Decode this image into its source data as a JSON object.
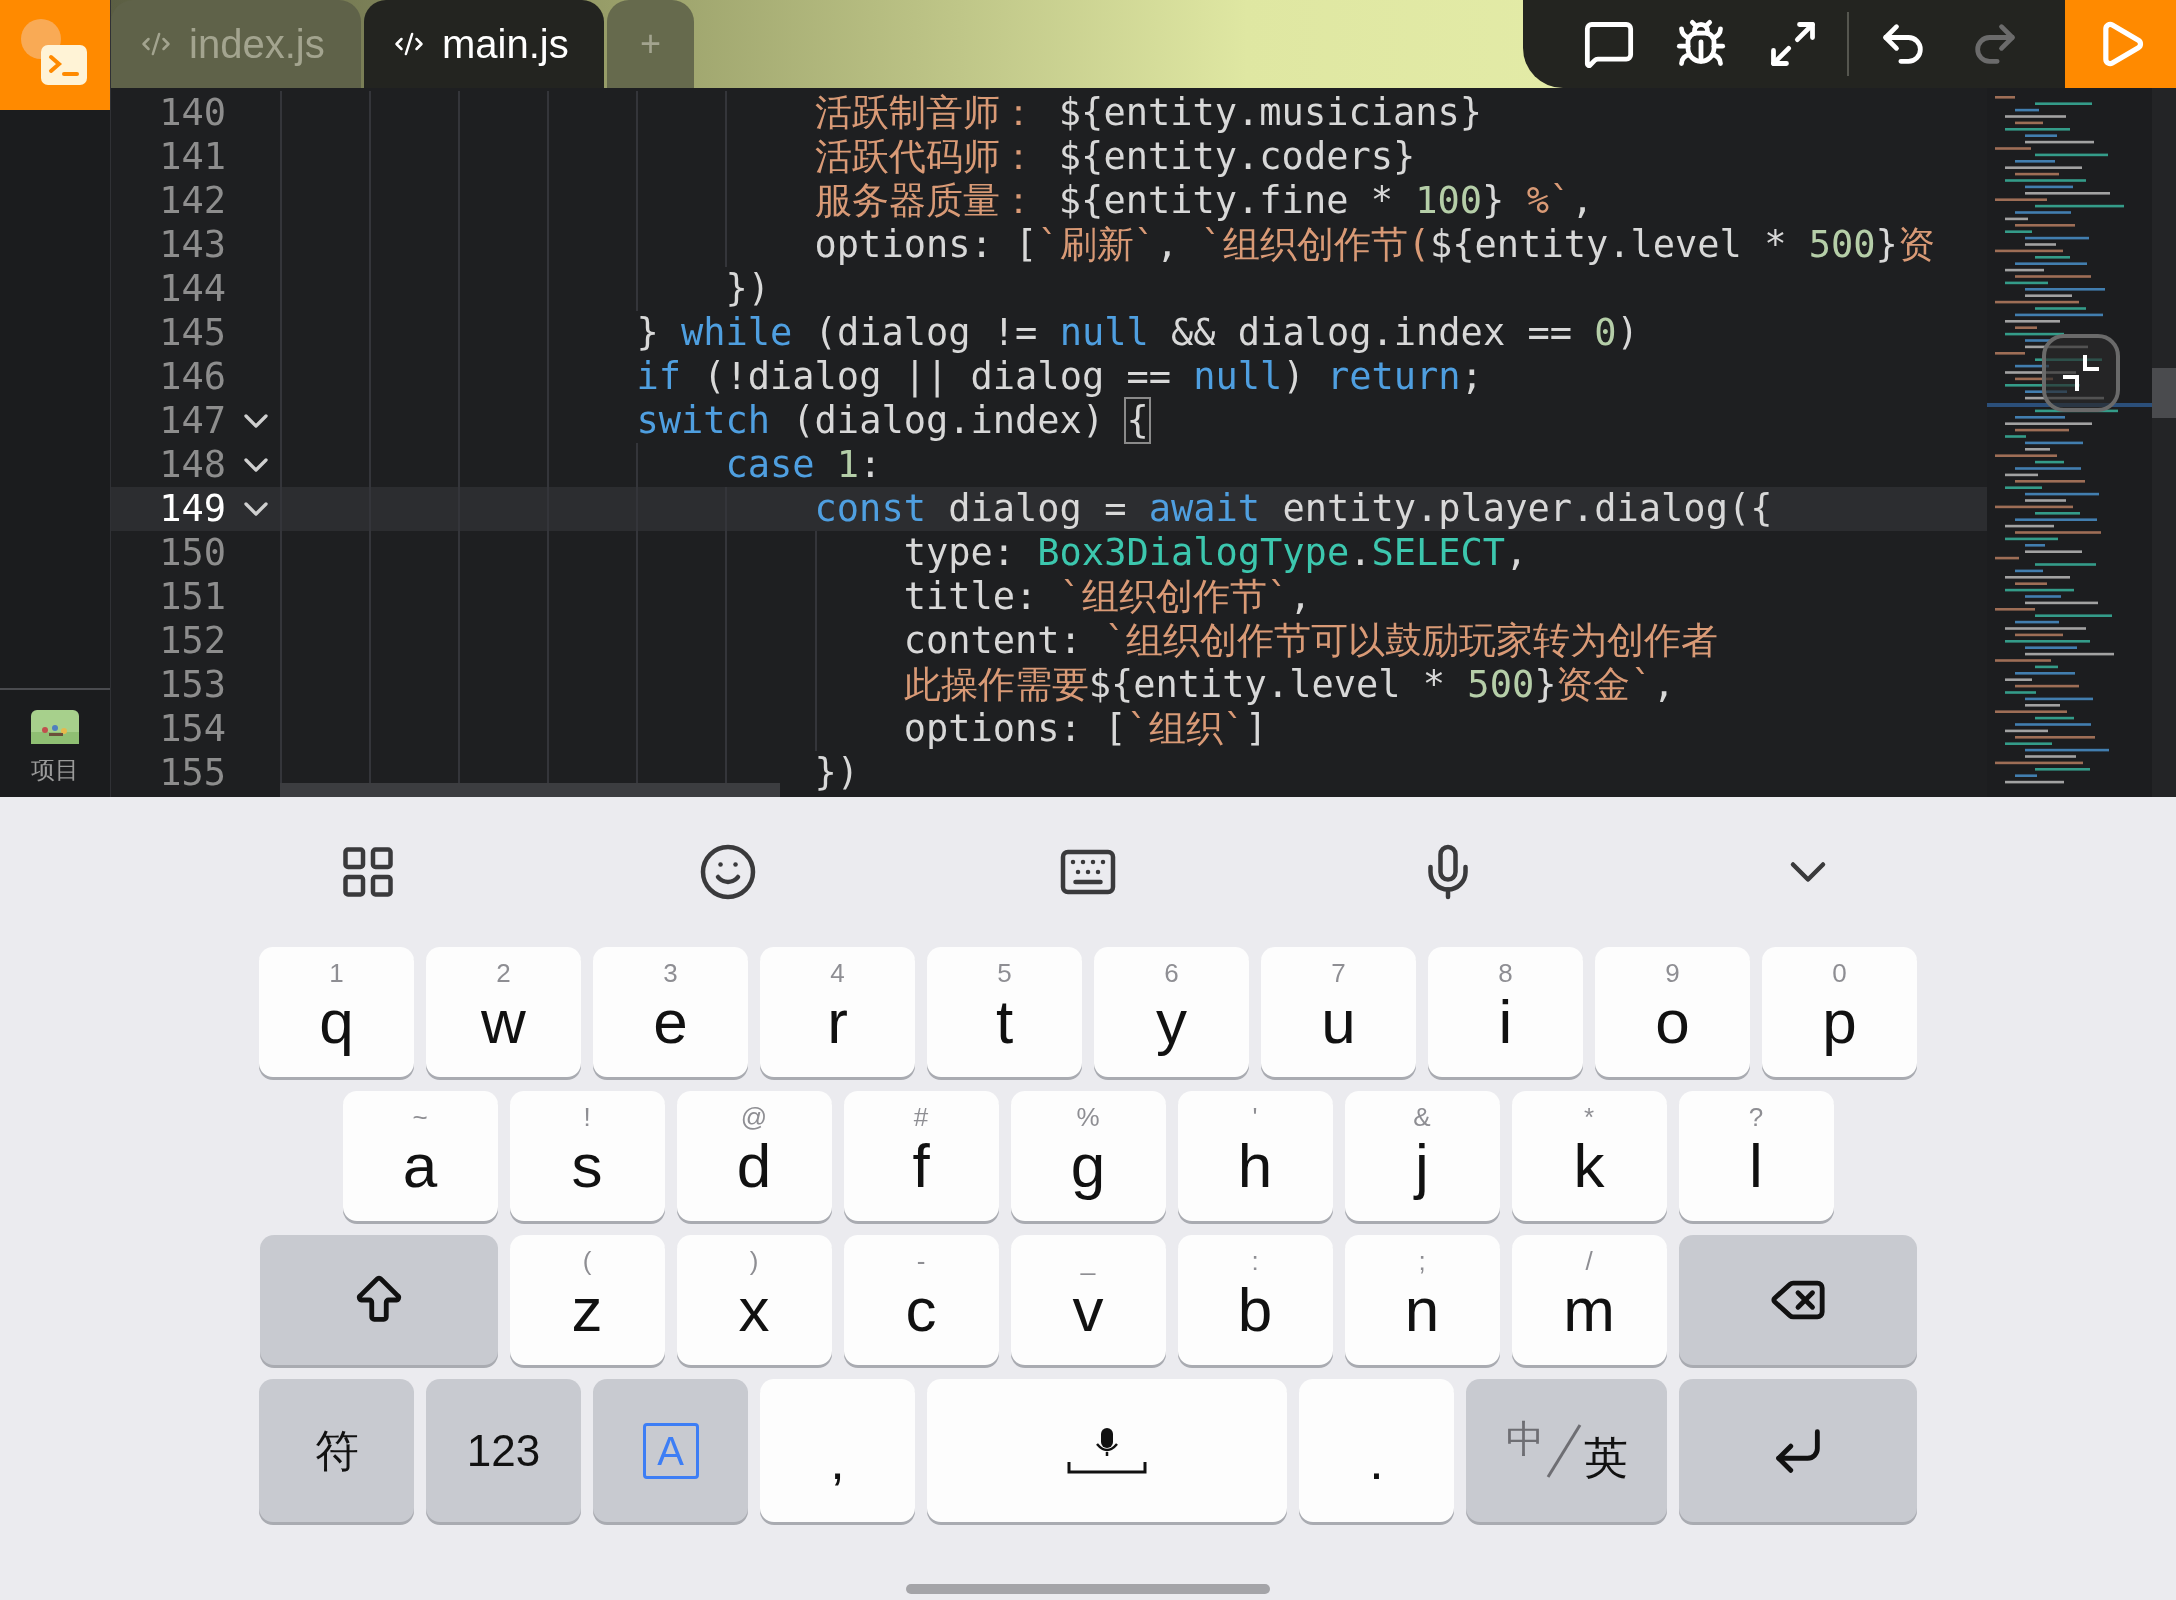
{
  "tabs": [
    {
      "label": "index.js",
      "selected": false
    },
    {
      "label": "main.js",
      "selected": true
    }
  ],
  "new_tab": "+",
  "toolbar": [
    {
      "kind": "comment",
      "disabled": false
    },
    {
      "kind": "debug",
      "disabled": false
    },
    {
      "kind": "expand",
      "disabled": false
    },
    {
      "kind": "undo",
      "disabled": false
    },
    {
      "kind": "redo",
      "disabled": true
    },
    {
      "kind": "run",
      "disabled": false
    }
  ],
  "sidebar": {
    "items": [
      {
        "label": "项目"
      }
    ]
  },
  "editor": {
    "lines": [
      {
        "number": "140",
        "current": false,
        "tokens": [
          {
            "text": "                        活跃制音师： ",
            "kind": "string"
          },
          {
            "text": "${entity.musicians}",
            "kind": "plain"
          }
        ]
      },
      {
        "number": "141",
        "current": false,
        "tokens": [
          {
            "text": "                        活跃代码师： ",
            "kind": "string"
          },
          {
            "text": "${entity.coders}",
            "kind": "plain"
          }
        ]
      },
      {
        "number": "142",
        "current": false,
        "tokens": [
          {
            "text": "                        服务器质量： ",
            "kind": "string"
          },
          {
            "text": "${entity.fine * ",
            "kind": "plain"
          },
          {
            "text": "100",
            "kind": "number"
          },
          {
            "text": "} ",
            "kind": "plain"
          },
          {
            "text": "%`",
            "kind": "string"
          },
          {
            "text": ",",
            "kind": "plain"
          }
        ]
      },
      {
        "number": "143",
        "current": false,
        "tokens": [
          {
            "text": "                        options: [",
            "kind": "plain"
          },
          {
            "text": "`刷新`",
            "kind": "string"
          },
          {
            "text": ", ",
            "kind": "plain"
          },
          {
            "text": "`组织创作节(",
            "kind": "string"
          },
          {
            "text": "${entity.level * ",
            "kind": "plain"
          },
          {
            "text": "500",
            "kind": "number"
          },
          {
            "text": "}",
            "kind": "plain"
          },
          {
            "text": "资",
            "kind": "string"
          }
        ]
      },
      {
        "number": "144",
        "current": false,
        "tokens": [
          {
            "text": "                    })",
            "kind": "plain"
          }
        ]
      },
      {
        "number": "145",
        "current": false,
        "tokens": [
          {
            "text": "                } ",
            "kind": "plain"
          },
          {
            "text": "while",
            "kind": "keyword"
          },
          {
            "text": " (dialog != ",
            "kind": "plain"
          },
          {
            "text": "null",
            "kind": "keyword"
          },
          {
            "text": " && dialog.index == ",
            "kind": "plain"
          },
          {
            "text": "0",
            "kind": "number"
          },
          {
            "text": ")",
            "kind": "plain"
          }
        ]
      },
      {
        "number": "146",
        "current": false,
        "tokens": [
          {
            "text": "                if",
            "kind": "keyword"
          },
          {
            "text": " (!dialog || dialog == ",
            "kind": "plain"
          },
          {
            "text": "null",
            "kind": "keyword"
          },
          {
            "text": ") ",
            "kind": "plain"
          },
          {
            "text": "return",
            "kind": "keyword"
          },
          {
            "text": ";",
            "kind": "plain"
          }
        ]
      },
      {
        "number": "147",
        "current": false,
        "expanded": true,
        "tokens": [
          {
            "text": "                switch",
            "kind": "keyword"
          },
          {
            "text": " (dialog.index) ",
            "kind": "plain"
          },
          {
            "text": "{",
            "kind": "match"
          }
        ]
      },
      {
        "number": "148",
        "current": false,
        "expanded": true,
        "tokens": [
          {
            "text": "                    case ",
            "kind": "keyword"
          },
          {
            "text": "1",
            "kind": "number"
          },
          {
            "text": ":",
            "kind": "plain"
          }
        ]
      },
      {
        "number": "149",
        "current": true,
        "expanded": true,
        "tokens": [
          {
            "text": "                        const",
            "kind": "keyword"
          },
          {
            "text": " dialog = ",
            "kind": "plain"
          },
          {
            "text": "await",
            "kind": "keyword"
          },
          {
            "text": " entity.player.dialog({",
            "kind": "plain"
          }
        ]
      },
      {
        "number": "150",
        "current": false,
        "tokens": [
          {
            "text": "                            type: ",
            "kind": "plain"
          },
          {
            "text": "Box3DialogType",
            "kind": "type"
          },
          {
            "text": ".",
            "kind": "plain"
          },
          {
            "text": "SELECT",
            "kind": "type"
          },
          {
            "text": ",",
            "kind": "plain"
          }
        ]
      },
      {
        "number": "151",
        "current": false,
        "tokens": [
          {
            "text": "                            title: ",
            "kind": "plain"
          },
          {
            "text": "`组织创作节`",
            "kind": "string"
          },
          {
            "text": ",",
            "kind": "plain"
          }
        ]
      },
      {
        "number": "152",
        "current": false,
        "tokens": [
          {
            "text": "                            content: ",
            "kind": "plain"
          },
          {
            "text": "`组织创作节可以鼓励玩家转为创作者",
            "kind": "string"
          }
        ]
      },
      {
        "number": "153",
        "current": false,
        "tokens": [
          {
            "text": "                            此操作需要",
            "kind": "string"
          },
          {
            "text": "${entity.level * ",
            "kind": "plain"
          },
          {
            "text": "500",
            "kind": "number"
          },
          {
            "text": "}",
            "kind": "plain"
          },
          {
            "text": "资金`",
            "kind": "string"
          },
          {
            "text": ",",
            "kind": "plain"
          }
        ]
      },
      {
        "number": "154",
        "current": false,
        "tokens": [
          {
            "text": "                            options: [",
            "kind": "plain"
          },
          {
            "text": "`组织`",
            "kind": "string"
          },
          {
            "text": "]",
            "kind": "plain"
          }
        ]
      },
      {
        "number": "155",
        "current": false,
        "tokens": [
          {
            "text": "                        })",
            "kind": "plain"
          }
        ]
      }
    ]
  },
  "keyboard": {
    "toolbar": [
      {
        "kind": "grid"
      },
      {
        "kind": "emoji"
      },
      {
        "kind": "keyboard"
      },
      {
        "kind": "voice"
      },
      {
        "kind": "collapse"
      }
    ],
    "rows": [
      {
        "keys": [
          {
            "kind": "letter",
            "label": "q",
            "hint": "1"
          },
          {
            "kind": "letter",
            "label": "w",
            "hint": "2"
          },
          {
            "kind": "letter",
            "label": "e",
            "hint": "3"
          },
          {
            "kind": "letter",
            "label": "r",
            "hint": "4"
          },
          {
            "kind": "letter",
            "label": "t",
            "hint": "5"
          },
          {
            "kind": "letter",
            "label": "y",
            "hint": "6"
          },
          {
            "kind": "letter",
            "label": "u",
            "hint": "7"
          },
          {
            "kind": "letter",
            "label": "i",
            "hint": "8"
          },
          {
            "kind": "letter",
            "label": "o",
            "hint": "9"
          },
          {
            "kind": "letter",
            "label": "p",
            "hint": "0"
          }
        ]
      },
      {
        "keys": [
          {
            "kind": "letter",
            "label": "a",
            "hint": "~"
          },
          {
            "kind": "letter",
            "label": "s",
            "hint": "!"
          },
          {
            "kind": "letter",
            "label": "d",
            "hint": "@"
          },
          {
            "kind": "letter",
            "label": "f",
            "hint": "#"
          },
          {
            "kind": "letter",
            "label": "g",
            "hint": "%"
          },
          {
            "kind": "letter",
            "label": "h",
            "hint": "'"
          },
          {
            "kind": "letter",
            "label": "j",
            "hint": "&"
          },
          {
            "kind": "letter",
            "label": "k",
            "hint": "*"
          },
          {
            "kind": "letter",
            "label": "l",
            "hint": "?"
          }
        ]
      },
      {
        "keys": [
          {
            "kind": "shift"
          },
          {
            "kind": "letter",
            "label": "z",
            "hint": "("
          },
          {
            "kind": "letter",
            "label": "x",
            "hint": ")"
          },
          {
            "kind": "letter",
            "label": "c",
            "hint": "-"
          },
          {
            "kind": "letter",
            "label": "v",
            "hint": "_"
          },
          {
            "kind": "letter",
            "label": "b",
            "hint": ":"
          },
          {
            "kind": "letter",
            "label": "n",
            "hint": ";"
          },
          {
            "kind": "letter",
            "label": "m",
            "hint": "/"
          },
          {
            "kind": "backspace"
          }
        ]
      },
      {
        "keys": [
          {
            "kind": "function",
            "label": "符"
          },
          {
            "kind": "function",
            "label": "123"
          },
          {
            "kind": "mode",
            "label": "A"
          },
          {
            "kind": "char",
            "label": ","
          },
          {
            "kind": "space"
          },
          {
            "kind": "char",
            "label": "."
          },
          {
            "kind": "lang",
            "secondary": "中",
            "primary": "英"
          },
          {
            "kind": "enter"
          }
        ]
      }
    ]
  }
}
